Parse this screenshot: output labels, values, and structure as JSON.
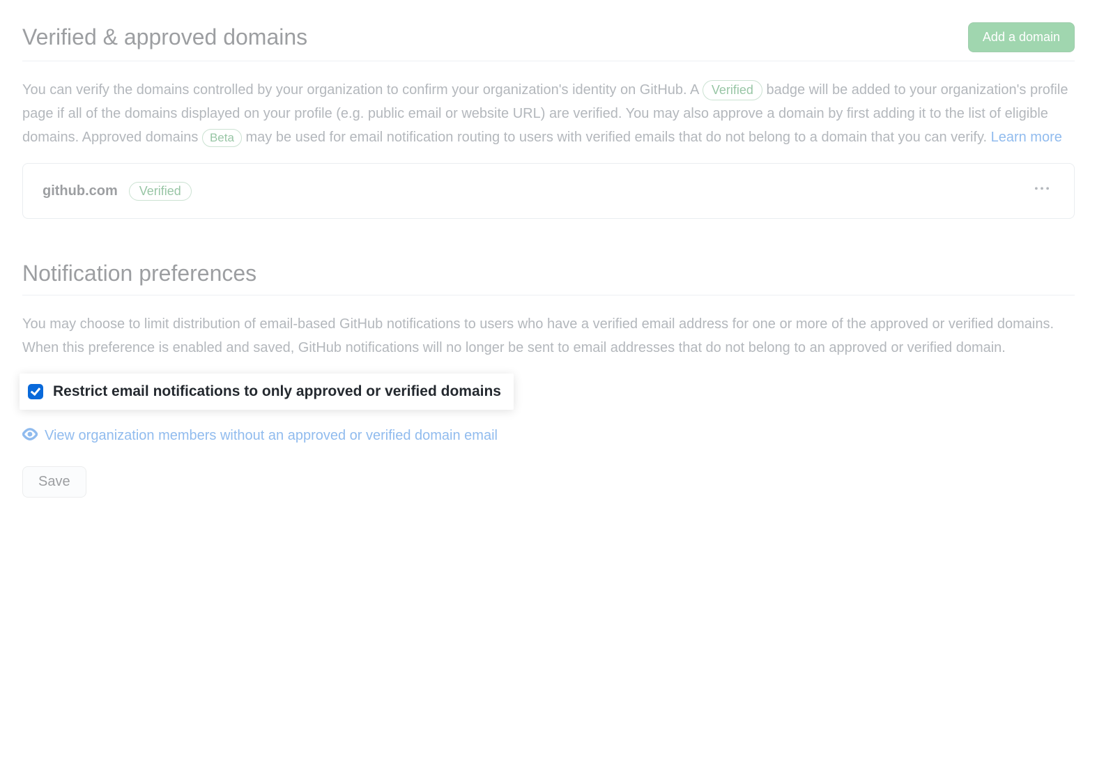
{
  "domains_section": {
    "title": "Verified & approved domains",
    "add_button": "Add a domain",
    "description_part1": "You can verify the domains controlled by your organization to confirm your organization's identity on GitHub. A ",
    "badge_verified": "Verified",
    "description_part2": " badge will be added to your organization's profile page if all of the domains displayed on your profile (e.g. public email or website URL) are verified. You may also approve a domain by first adding it to the list of eligible domains. Approved domains ",
    "badge_beta": "Beta",
    "description_part3": " may be used for email notification routing to users with verified emails that do not belong to a domain that you can verify. ",
    "learn_more": "Learn more",
    "domain_list": [
      {
        "name": "github.com",
        "status": "Verified"
      }
    ]
  },
  "notification_section": {
    "title": "Notification preferences",
    "description": "You may choose to limit distribution of email-based GitHub notifications to users who have a verified email address for one or more of the approved or verified domains. When this preference is enabled and saved, GitHub notifications will no longer be sent to email addresses that do not belong to an approved or verified domain.",
    "checkbox_label": "Restrict email notifications to only approved or verified domains",
    "checkbox_checked": true,
    "view_members_link": "View organization members without an approved or verified domain email",
    "save_button": "Save"
  }
}
